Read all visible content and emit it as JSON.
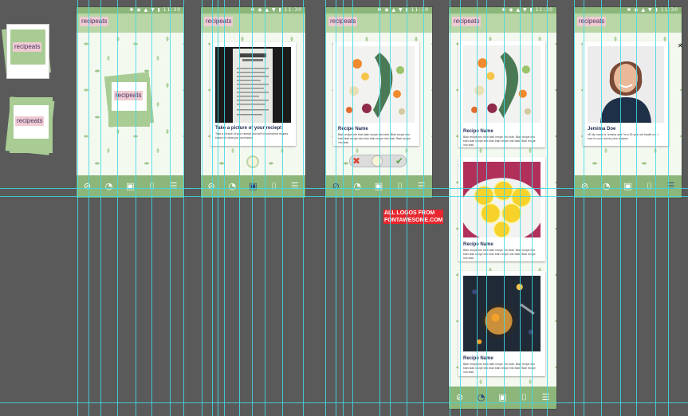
{
  "brand": "recipeats",
  "status_icons": "✱ ◉ ▲ ▼ ▮ 11:30",
  "screen2": {
    "caption_title": "Take a picture of your reciept",
    "caption_desc": "Take a picture of your receipt and we'll recommend recipes based on what you purchased"
  },
  "recipe": {
    "name": "Recipe Name",
    "desc": "Blah recipe info blah blah recipe info blah. Blah recipe info blah blah recipe info blah blah recipe info blah. Blah recipe info blah."
  },
  "profile": {
    "name": "Jemima Doe",
    "bio": "Hi! My name is Jemima and I'm a 25 year old health nut. I love to cook and try new recipes!"
  },
  "note": {
    "line1": "ALL LOGOS FROM",
    "line2": "FONTAWESOME.COM"
  },
  "nav_icons": [
    "compass-icon",
    "fire-icon",
    "gift-icon",
    "bookmark-icon",
    "sliders-icon"
  ],
  "colors": {
    "green_dark": "#8cb67a",
    "green_light": "#b9d6a6",
    "label_pink": "#efcbd2",
    "label_text": "#4a3266",
    "guide": "#3fd9e6"
  }
}
